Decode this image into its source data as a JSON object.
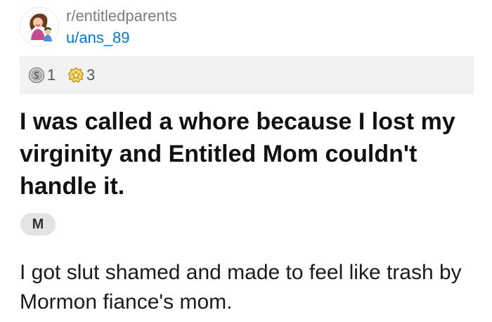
{
  "post": {
    "subreddit": "r/entitledparents",
    "username": "u/ans_89",
    "awards": [
      {
        "icon": "silver-award-icon",
        "count": "1",
        "color": "#b9b9b9"
      },
      {
        "icon": "gold-award-icon",
        "count": "3",
        "color": "#e8c245"
      }
    ],
    "title": "I was called a whore because I lost my virginity and Entitled Mom couldn't handle it.",
    "flair": "M",
    "body": "I got slut shamed and made to feel like trash by Mormon fiance's mom."
  },
  "colors": {
    "username_link": "#0079d3",
    "subreddit_text": "#7c7c7c",
    "award_bar_bg": "#f2f2f2",
    "flair_bg": "#e3e3e3"
  }
}
